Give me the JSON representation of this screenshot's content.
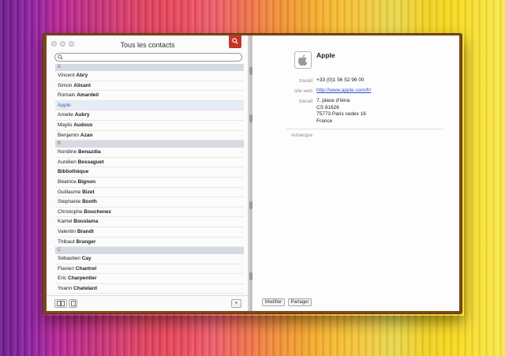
{
  "window": {
    "title": "Tous les contacts"
  },
  "search": {
    "placeholder": ""
  },
  "contacts": [
    {
      "section": "A"
    },
    {
      "first": "Vincent",
      "last": "Abry"
    },
    {
      "first": "Simon",
      "last": "Alixant"
    },
    {
      "first": "Romain",
      "last": "Amardeil"
    },
    {
      "first": "",
      "last": "",
      "org": "Apple",
      "selected": true
    },
    {
      "first": "Amelie",
      "last": "Aubry"
    },
    {
      "first": "Maylis",
      "last": "Audoux"
    },
    {
      "first": "Benjamin",
      "last": "Azan"
    },
    {
      "section": "B"
    },
    {
      "first": "Noridine",
      "last": "Benazdia"
    },
    {
      "first": "Aurélien",
      "last": "Bessaguet"
    },
    {
      "first": "",
      "last": "",
      "org_bold": "Bibliothèque"
    },
    {
      "first": "Béatrice",
      "last": "Bignon"
    },
    {
      "first": "Guillaume",
      "last": "Bizet"
    },
    {
      "first": "Stephanie",
      "last": "Booth"
    },
    {
      "first": "Christophe",
      "last": "Bouchenez"
    },
    {
      "first": "Kamel",
      "last": "Bouslama"
    },
    {
      "first": "Valentin",
      "last": "Brandt"
    },
    {
      "first": "Thibaut",
      "last": "Branger"
    },
    {
      "section": "C"
    },
    {
      "first": "Sébastien",
      "last": "Cay"
    },
    {
      "first": "Flavien",
      "last": "Chantrel"
    },
    {
      "first": "Eric",
      "last": "Charpentier"
    },
    {
      "first": "Yoann",
      "last": "Chatelard"
    }
  ],
  "detail": {
    "name": "Apple",
    "fields": [
      {
        "label": "travail",
        "value": "+33 (0)1 56 52 96 00",
        "link": false
      },
      {
        "label": "site web",
        "value": "http://www.apple.com/fr/",
        "link": true
      },
      {
        "label": "travail",
        "lines": [
          "7, place d'Iéna",
          "CS 81626",
          "75773 Paris cedex 16",
          "France"
        ]
      }
    ],
    "note_label": "remarque"
  },
  "buttons": {
    "edit": "Modifier",
    "share": "Partager",
    "add": "+"
  },
  "colors": {
    "bookmark": "#c6352a",
    "section": "#d6dbe2",
    "selected_text": "#3a66b8",
    "link": "#2a53c9",
    "cover": "#7a4a1c"
  }
}
